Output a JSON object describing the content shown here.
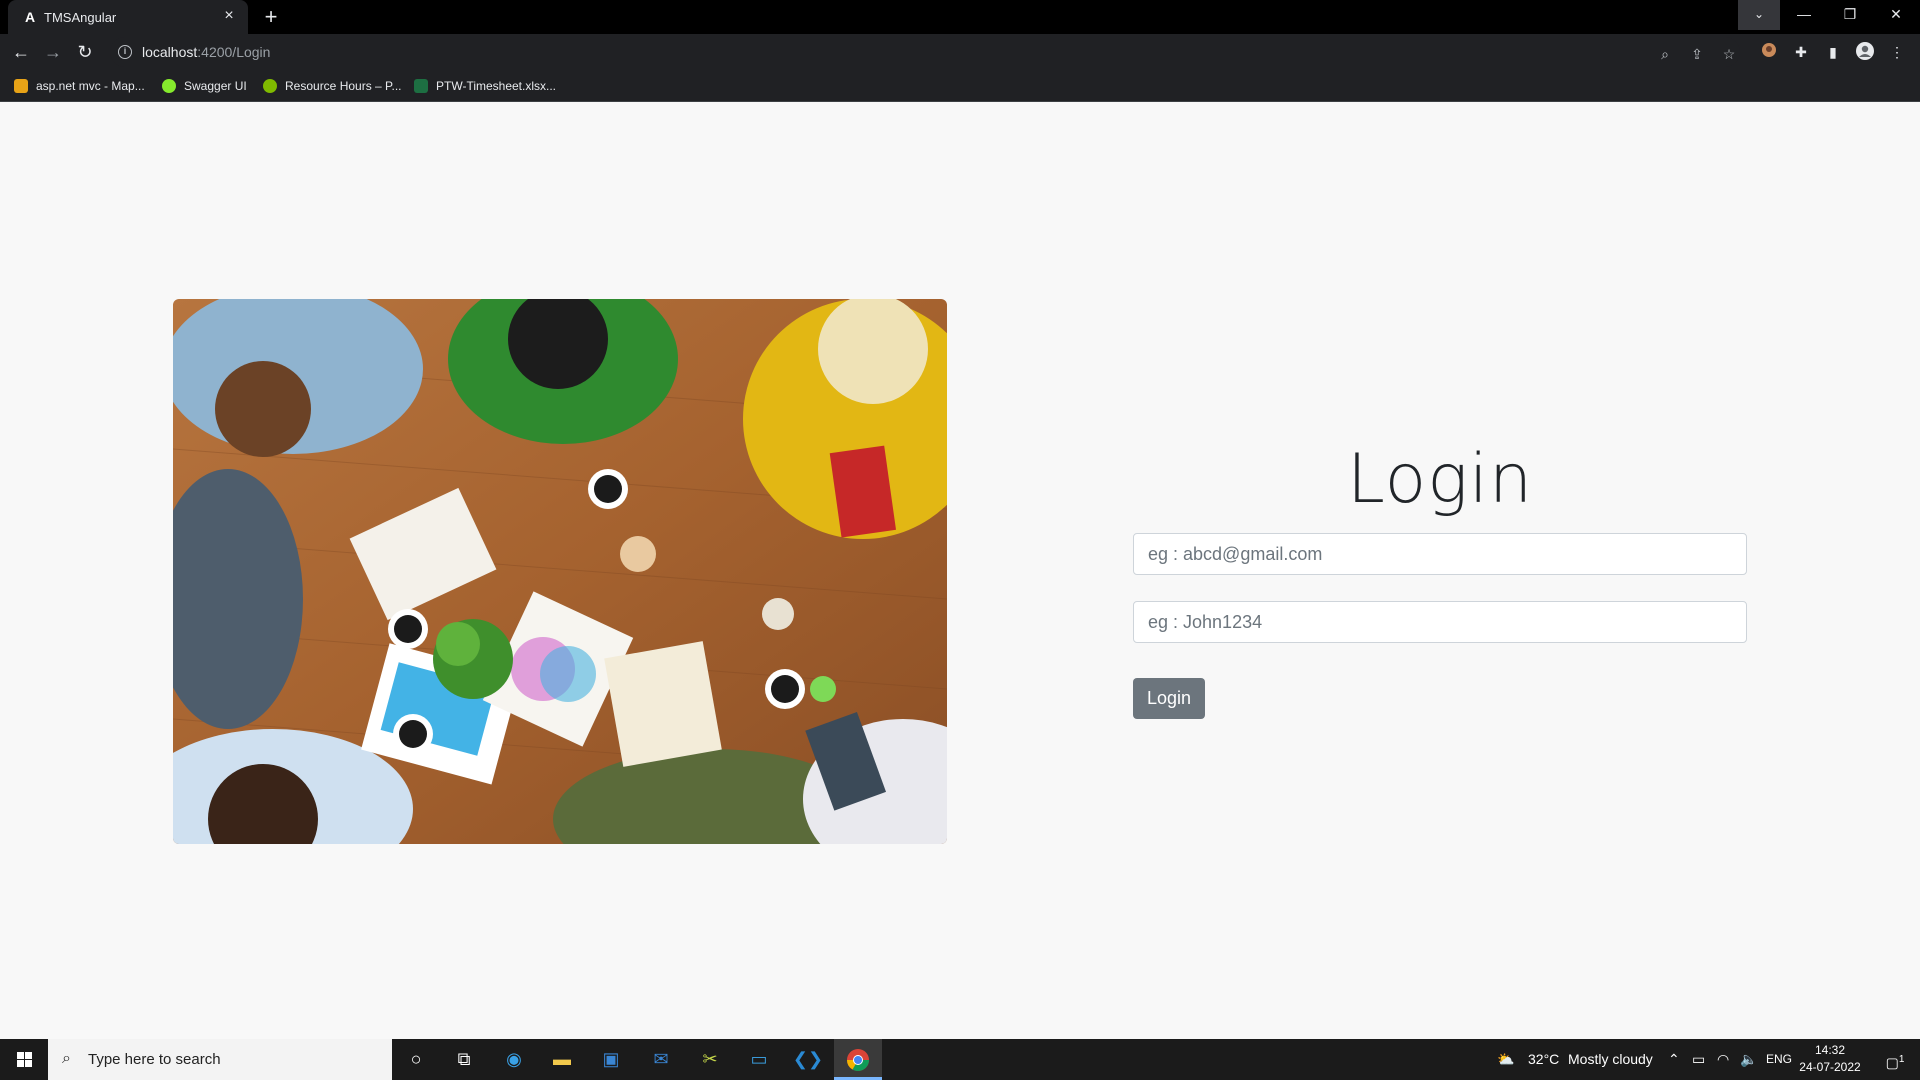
{
  "browser": {
    "tab_title": "TMSAngular",
    "tab_close": "×",
    "new_tab": "+",
    "url_host": "localhost",
    "url_path": ":4200/Login",
    "bookmarks": [
      {
        "label": "asp.net mvc - Map...",
        "color": "#e8a317"
      },
      {
        "label": "Swagger UI",
        "color": "#85ea2d"
      },
      {
        "label": "Resource Hours – P...",
        "color": "#7fba00"
      },
      {
        "label": "PTW-Timesheet.xlsx...",
        "color": "#1d6f42"
      }
    ]
  },
  "login": {
    "title": "Login",
    "email_placeholder": "eg : abcd@gmail.com",
    "password_placeholder": "eg : John1234",
    "button_label": "Login"
  },
  "taskbar": {
    "search_placeholder": "Type here to search",
    "weather_temp": "32°C",
    "weather_text": "Mostly cloudy",
    "language": "ENG",
    "time": "14:32",
    "date": "24-07-2022",
    "notification_count": "1"
  },
  "colors": {
    "page_bg": "#f8f8f8",
    "button_bg": "#6c757d",
    "titlebar_bg": "#000000",
    "toolbar_bg": "#202124",
    "taskbar_bg": "#1b1b1b"
  }
}
